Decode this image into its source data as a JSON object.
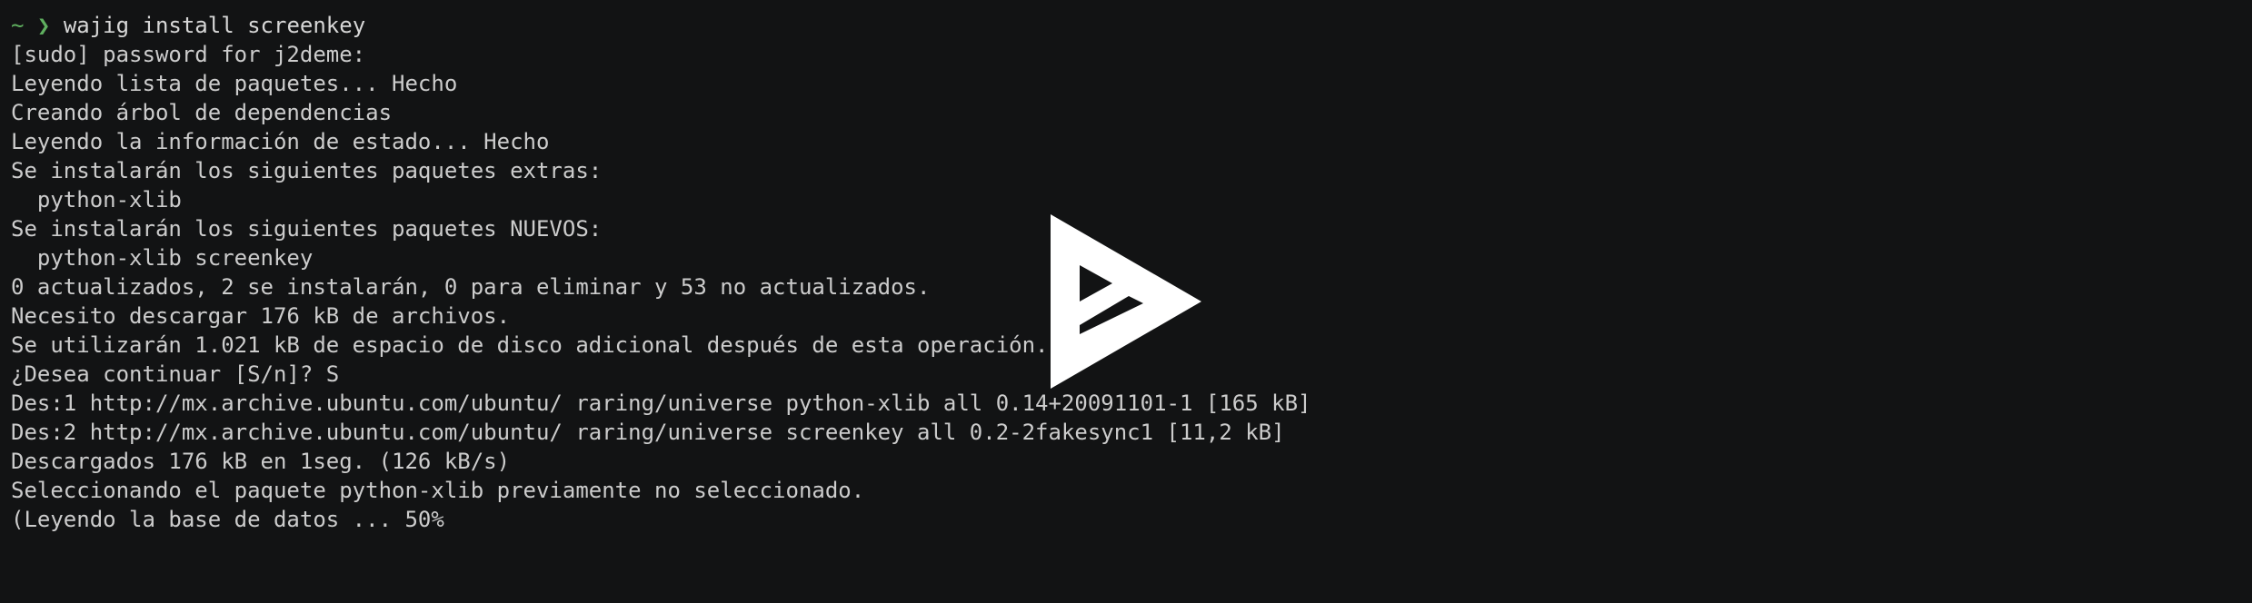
{
  "theme": {
    "background": "#121314",
    "foreground": "#cccccc",
    "prompt_color": "#5faf5f",
    "overlay_color": "#ffffff"
  },
  "prompt": {
    "tilde": "~",
    "arrow": "❯",
    "command": "wajig install screenkey"
  },
  "output_lines": [
    "[sudo] password for j2deme:",
    "Leyendo lista de paquetes... Hecho",
    "Creando árbol de dependencias",
    "Leyendo la información de estado... Hecho",
    "Se instalarán los siguientes paquetes extras:",
    "  python-xlib",
    "Se instalarán los siguientes paquetes NUEVOS:",
    "  python-xlib screenkey",
    "0 actualizados, 2 se instalarán, 0 para eliminar y 53 no actualizados.",
    "Necesito descargar 176 kB de archivos.",
    "Se utilizarán 1.021 kB de espacio de disco adicional después de esta operación.",
    "¿Desea continuar [S/n]? S",
    "Des:1 http://mx.archive.ubuntu.com/ubuntu/ raring/universe python-xlib all 0.14+20091101-1 [165 kB]",
    "Des:2 http://mx.archive.ubuntu.com/ubuntu/ raring/universe screenkey all 0.2-2fakesync1 [11,2 kB]",
    "Descargados 176 kB en 1seg. (126 kB/s)",
    "Seleccionando el paquete python-xlib previamente no seleccionado.",
    "(Leyendo la base de datos ... 50%"
  ],
  "overlay": {
    "icon": "asciinema-play-icon"
  }
}
